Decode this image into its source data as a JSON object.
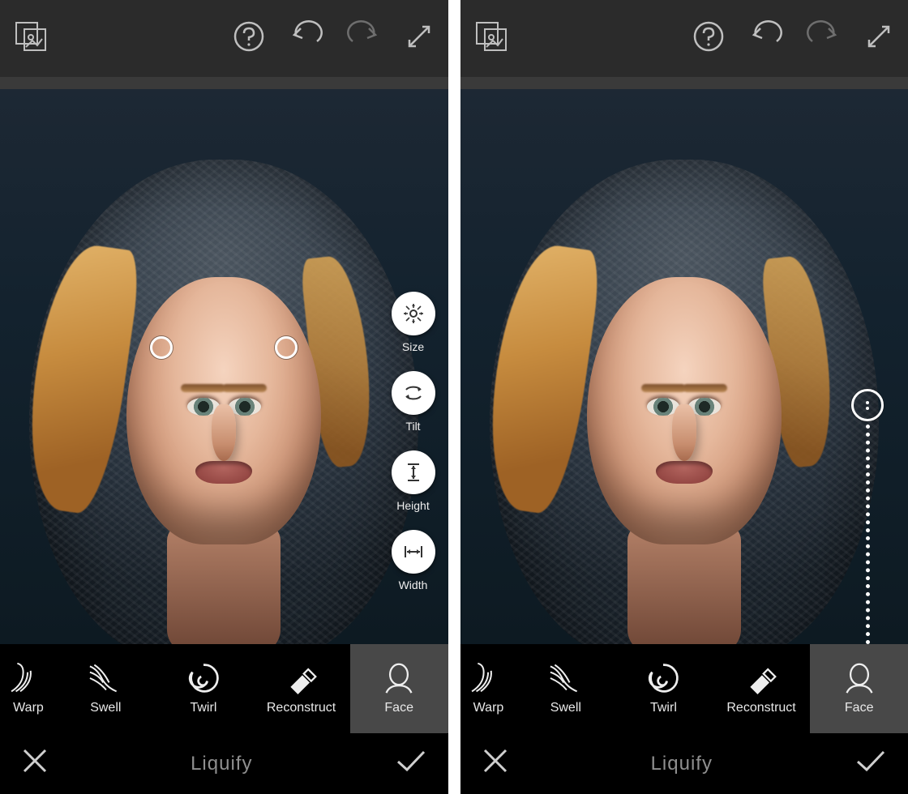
{
  "top": {
    "compare_icon": "compare",
    "help_icon": "help",
    "undo_icon": "undo",
    "redo_icon": "redo",
    "fullscreen_icon": "expand"
  },
  "tools": [
    {
      "label": "Warp"
    },
    {
      "label": "Swell"
    },
    {
      "label": "Twirl"
    },
    {
      "label": "Reconstruct"
    },
    {
      "label": "Face"
    }
  ],
  "face_menu": [
    {
      "label": "Size"
    },
    {
      "label": "Tilt"
    },
    {
      "label": "Height"
    },
    {
      "label": "Width"
    }
  ],
  "confirm": {
    "title": "Liquify"
  }
}
